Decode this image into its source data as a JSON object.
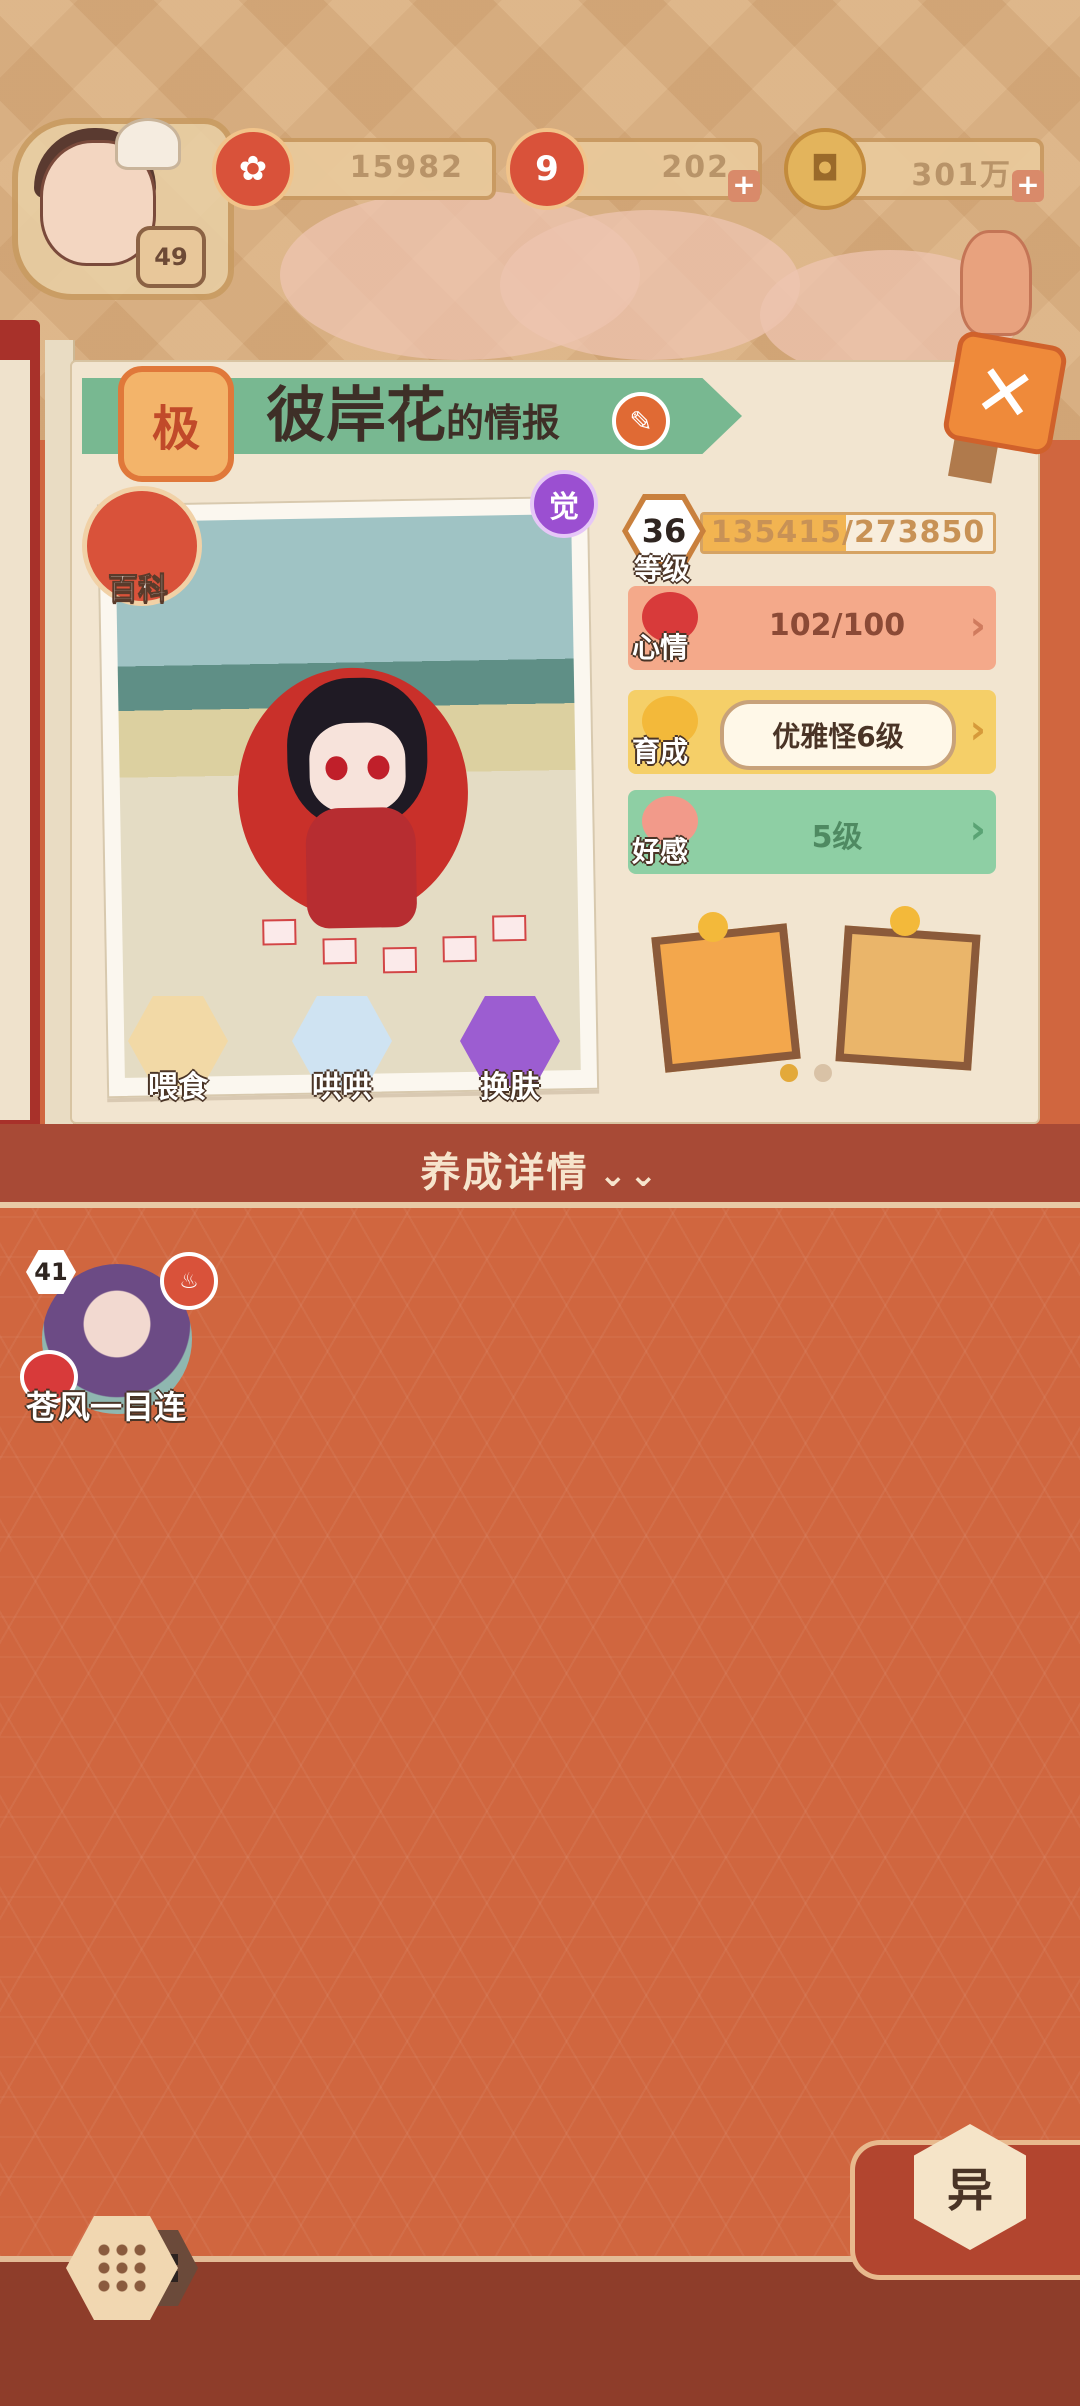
{
  "top_bar": {
    "player_level": "49",
    "resources": [
      {
        "name": "flower-currency",
        "value": "15982"
      },
      {
        "name": "stamina",
        "value": "202"
      },
      {
        "name": "coins",
        "value": "301万"
      }
    ]
  },
  "panel": {
    "grade": "极",
    "title_name": "彼岸花",
    "title_suffix": "的情报",
    "awaken_badge": "觉",
    "baike_label": "百科",
    "actions": [
      "喂食",
      "哄哄",
      "换肤"
    ],
    "level": {
      "value": "36",
      "label": "等级",
      "exp_text": "135415/273850",
      "exp_current": 135415,
      "exp_max": 273850
    },
    "mood": {
      "label": "心情",
      "value": "102/100"
    },
    "growth": {
      "label": "育成",
      "value": "优雅怪6级"
    },
    "affection": {
      "label": "好感",
      "value": "5级"
    },
    "carousel_dots": 2,
    "carousel_active": 0
  },
  "section": {
    "label": "养成详情",
    "chevron": "⌄⌄"
  },
  "members": [
    {
      "level": "41",
      "name": "苍风一目连"
    }
  ],
  "footer": {
    "yi_label": "异"
  },
  "colors": {
    "ribbon_green": "#78b891",
    "mood_salmon": "#f4a98a",
    "growth_yellow": "#f5cf68",
    "affection_green": "#8ecfa4",
    "section_bg": "#d0663f"
  }
}
